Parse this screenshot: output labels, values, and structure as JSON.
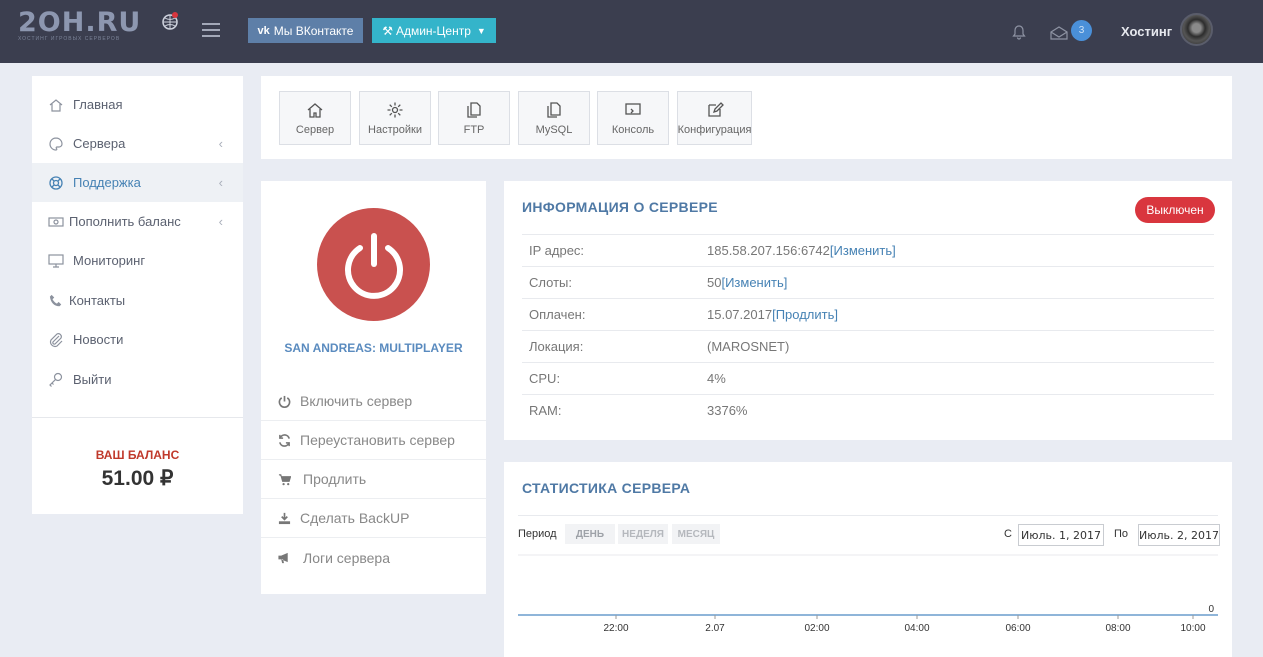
{
  "header": {
    "logo_text": "2OH.RU",
    "logo_subtitle": "ХОСТИНГ ИГРОВЫХ СЕРВЕРОВ",
    "vk_button": "Мы ВКонтакте",
    "admin_button": "Админ-Центр",
    "mail_count": "3",
    "user_name": "Хостинг"
  },
  "sidebar": {
    "items": [
      {
        "label": "Главная",
        "icon": "home-icon"
      },
      {
        "label": "Сервера",
        "icon": "palette-icon"
      },
      {
        "label": "Поддержка",
        "icon": "lifebuoy-icon"
      },
      {
        "label": "Пополнить баланс",
        "icon": "money-icon"
      },
      {
        "label": "Мониторинг",
        "icon": "monitor-icon"
      },
      {
        "label": "Контакты",
        "icon": "phone-icon"
      },
      {
        "label": "Новости",
        "icon": "paperclip-icon"
      },
      {
        "label": "Выйти",
        "icon": "key-icon"
      }
    ],
    "arrow": "‹",
    "balance_label": "ВАШ БАЛАНС",
    "balance_value": "51.00 ₽"
  },
  "toolbar": {
    "buttons": [
      {
        "label": "Сервер",
        "icon": "home-icon"
      },
      {
        "label": "Настройки",
        "icon": "gear-icon"
      },
      {
        "label": "FTP",
        "icon": "files-icon"
      },
      {
        "label": "MySQL",
        "icon": "files-icon"
      },
      {
        "label": "Консоль",
        "icon": "console-icon"
      },
      {
        "label": "Конфигурация",
        "icon": "edit-icon"
      }
    ]
  },
  "server": {
    "game_name": "SAN ANDREAS: MULTIPLAYER",
    "actions": [
      {
        "label": "Включить сервер",
        "icon": "power-icon"
      },
      {
        "label": "Переустановить сервер",
        "icon": "refresh-icon"
      },
      {
        "label": "Продлить",
        "icon": "cart-icon"
      },
      {
        "label": "Сделать BackUP",
        "icon": "download-icon"
      },
      {
        "label": "Логи сервера",
        "icon": "megaphone-icon"
      }
    ]
  },
  "info": {
    "title": "ИНФОРМАЦИЯ О СЕРВЕРЕ",
    "status": "Выключен",
    "status_color": "#d9363e",
    "rows": [
      {
        "key": "IP адрес:",
        "value": "185.58.207.156:6742",
        "link": "[Изменить]"
      },
      {
        "key": "Слоты:",
        "value": "50",
        "link": "[Изменить]"
      },
      {
        "key": "Оплачен:",
        "value": "15.07.2017",
        "link": "[Продлить]"
      },
      {
        "key": "Локация:",
        "value": "(MAROSNET)",
        "link": ""
      },
      {
        "key": "CPU:",
        "value": "4%",
        "link": ""
      },
      {
        "key": "RAM:",
        "value": "3376%",
        "link": ""
      }
    ]
  },
  "stats": {
    "title": "СТАТИСТИКА СЕРВЕРА",
    "period_label": "Период",
    "periods": [
      "ДЕНЬ",
      "НЕДЕЛЯ",
      "МЕСЯЦ"
    ],
    "from_label": "С",
    "from_date": "Июль. 1, 2017",
    "to_label": "По",
    "to_date": "Июль. 2, 2017"
  },
  "chart_data": {
    "type": "line",
    "x": [
      "22:00",
      "2.07",
      "02:00",
      "04:00",
      "06:00",
      "08:00",
      "10:00"
    ],
    "series": [
      {
        "values": [
          0,
          0,
          0,
          0,
          0,
          0,
          0
        ]
      }
    ],
    "y_tick_labels": [
      "0"
    ],
    "ylim": [
      0,
      1
    ],
    "grid": true,
    "line_color": "#8fb5d9"
  }
}
